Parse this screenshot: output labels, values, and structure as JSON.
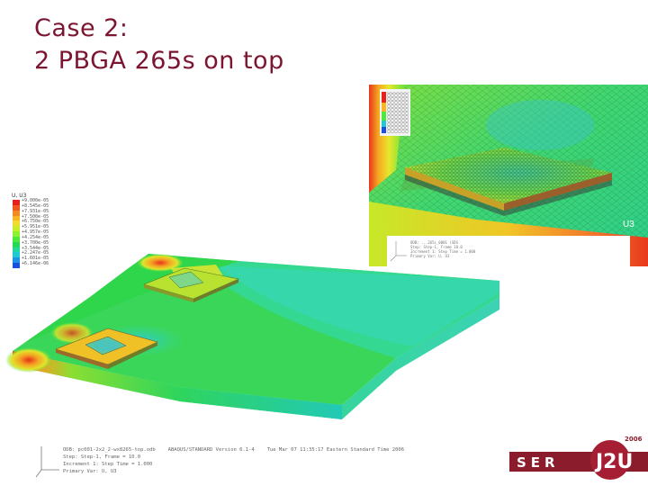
{
  "slide": {
    "title_line1": "Case 2:",
    "title_line2": "2 PBGA 265s on top"
  },
  "legend": {
    "title": "U, U3",
    "values": [
      "+9.000e-05",
      "+8.545e-05",
      "+7.931e-05",
      "+7.500e-05",
      "+6.750e-05",
      "+5.951e-05",
      "+4.957e-05",
      "+4.254e-05",
      "+3.700e-05",
      "+3.544e-05",
      "+2.247e-05",
      "+1.601e-05",
      "+6.146e-06"
    ],
    "colors": [
      "#e5231b",
      "#ee5a1c",
      "#f48a22",
      "#f9b526",
      "#f2dc2a",
      "#c9ec2a",
      "#8cf033",
      "#4ee83c",
      "#26d85a",
      "#22d99c",
      "#22c8d2",
      "#1f92e6",
      "#1a4fe0"
    ]
  },
  "inset": {
    "label": "U3",
    "meta": [
      "ODB: ...265s_0001 (SDS",
      "Step: Step-1, Frame 10.0",
      "Increment   1: Step Time = 1.000",
      "Primary Var: U, U3"
    ]
  },
  "footer": {
    "line1": [
      "ODB: pc001-2x2_2-wx8265-top.odb",
      "ABAQUS/STANDARD  Version 6.1-4",
      "Tue Mar 07 11:35:17 Eastern Standard Time 2006"
    ],
    "line2": "Step: Step-1, Frame = 10.0",
    "line3": "Increment    1: Step Time =    1.000",
    "line4": "Primary Var: U, U3"
  },
  "logo": {
    "text": "SER",
    "mark": "J2U",
    "year": "2006"
  }
}
